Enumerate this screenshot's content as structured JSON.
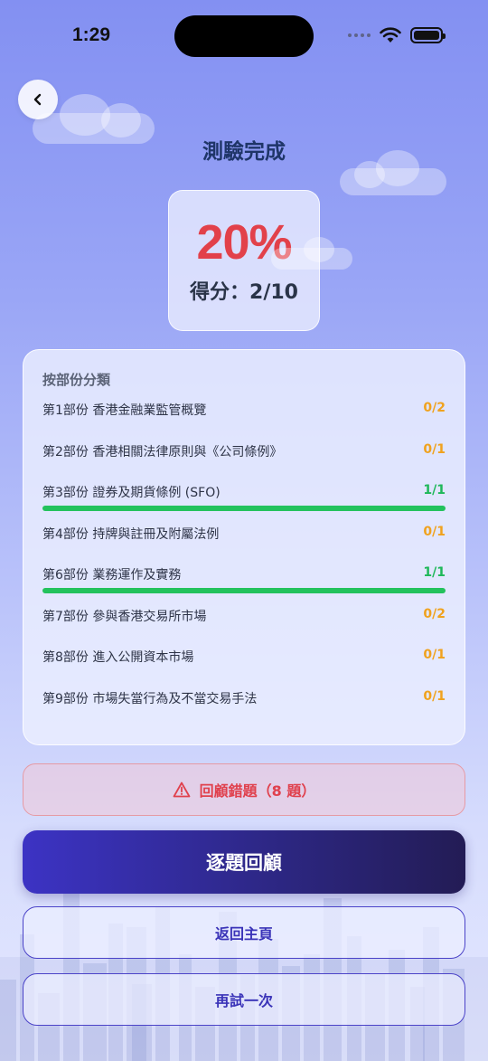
{
  "status_bar": {
    "time": "1:29"
  },
  "header": {
    "title": "測驗完成"
  },
  "score": {
    "percent": "20%",
    "label": "得分：2/10"
  },
  "sections": {
    "heading": "按部份分類",
    "rows": [
      {
        "label": "第1部份 香港金融業監管概覽",
        "score": "0/2",
        "fraction": 0
      },
      {
        "label": "第2部份 香港相關法律原則與《公司條例》",
        "score": "0/1",
        "fraction": 0
      },
      {
        "label": "第3部份 證券及期貨條例 (SFO)",
        "score": "1/1",
        "fraction": 1
      },
      {
        "label": "第4部份 持牌與註冊及附屬法例",
        "score": "0/1",
        "fraction": 0
      },
      {
        "label": "第6部份 業務運作及實務",
        "score": "1/1",
        "fraction": 1
      },
      {
        "label": "第7部份 參與香港交易所市場",
        "score": "0/2",
        "fraction": 0
      },
      {
        "label": "第8部份 進入公開資本市場",
        "score": "0/1",
        "fraction": 0
      },
      {
        "label": "第9部份 市場失當行為及不當交易手法",
        "score": "0/1",
        "fraction": 0
      }
    ]
  },
  "actions": {
    "review_wrong": "回顧錯題（8 題）",
    "review_all": "逐題回顧",
    "home": "返回主頁",
    "retry": "再試一次"
  },
  "colors": {
    "accent": "#3c33c4",
    "error": "#e2414a",
    "partial": "#f0a21e",
    "success": "#23c25d"
  },
  "icons": [
    "back-chevron-icon",
    "warning-icon",
    "wifi-icon",
    "battery-icon",
    "signal-icon"
  ]
}
